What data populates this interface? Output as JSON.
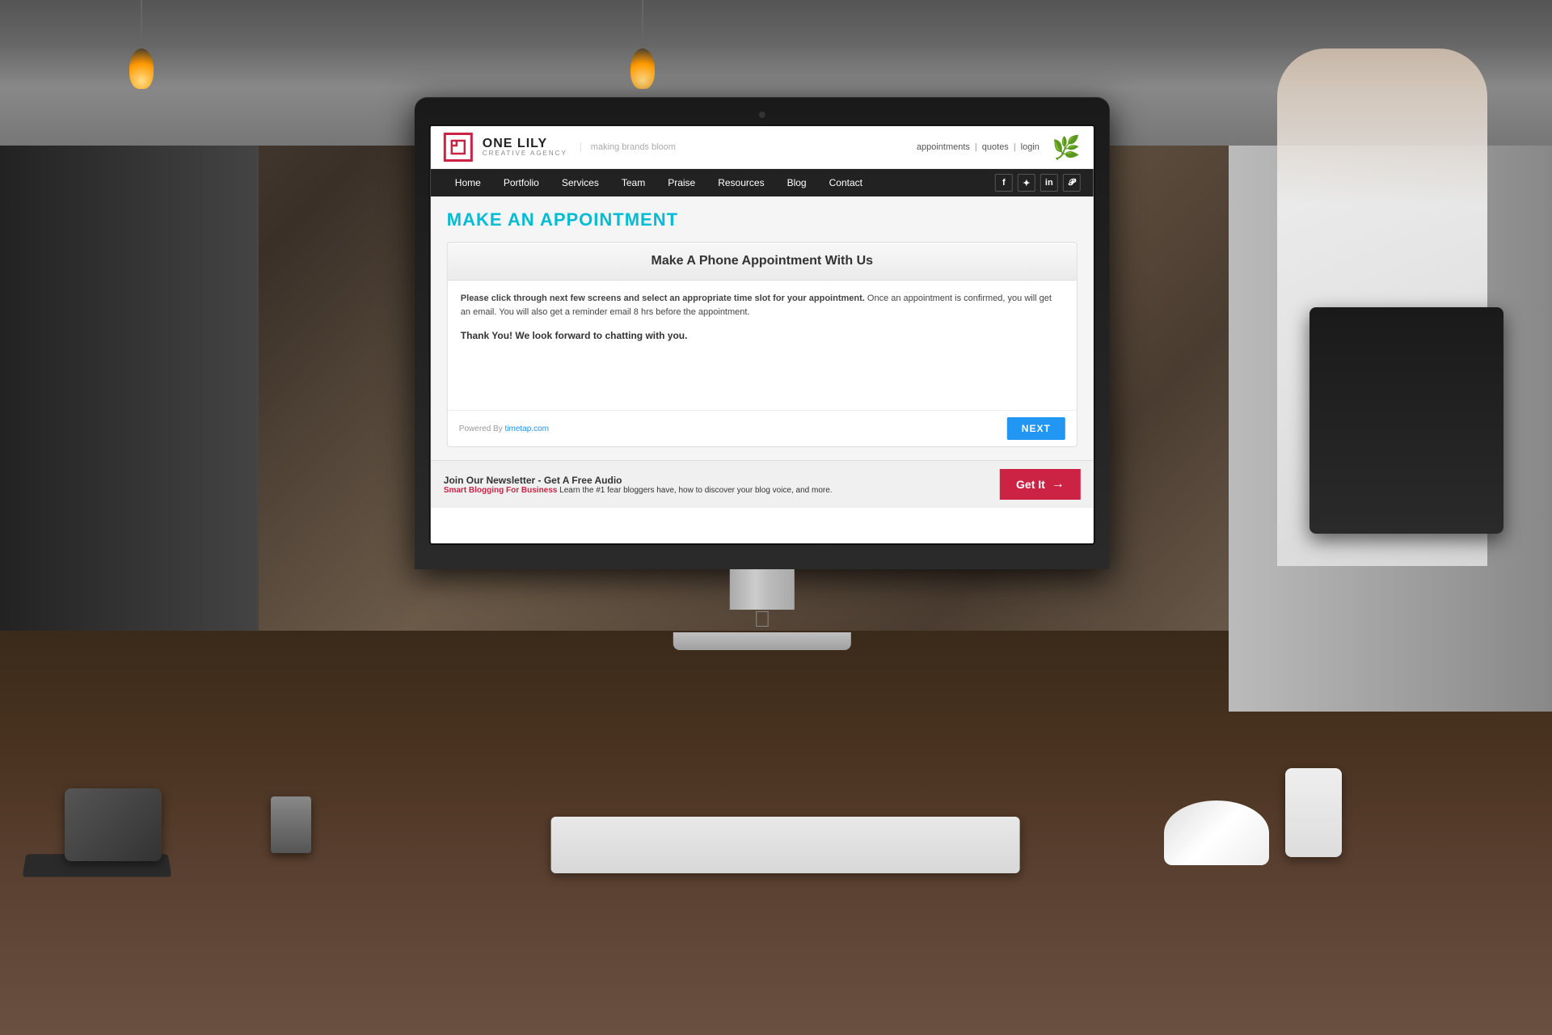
{
  "background": {
    "color": "#2a2a2a"
  },
  "website": {
    "header": {
      "logo_name": "ONE LILY",
      "logo_sub": "CREATIVE AGENCY",
      "logo_tagline": "making brands bloom",
      "top_links": {
        "appointments": "appointments",
        "quotes": "quotes",
        "login": "login",
        "separator": "|"
      }
    },
    "nav": {
      "items": [
        {
          "label": "Home"
        },
        {
          "label": "Portfolio"
        },
        {
          "label": "Services"
        },
        {
          "label": "Team"
        },
        {
          "label": "Praise"
        },
        {
          "label": "Resources"
        },
        {
          "label": "Blog"
        },
        {
          "label": "Contact"
        }
      ],
      "social": [
        "f",
        "t",
        "in",
        "p"
      ]
    },
    "page": {
      "title": "MAKE AN APPOINTMENT",
      "appointment_box": {
        "header": "Make A Phone Appointment With Us",
        "intro_bold": "Please click through next few screens and select an appropriate time slot for your appointment.",
        "intro_rest": " Once an appointment is confirmed, you will get an email. You will also get a reminder email 8 hrs before the appointment.",
        "thanks": "Thank You! We look forward to chatting with you.",
        "powered_by_label": "Powered By",
        "powered_by_link": "timetap.com",
        "next_button": "NEXT"
      }
    },
    "newsletter": {
      "main_label": "Join Our Newsletter - Get A Free Audio",
      "sub_bold": "Smart Blogging For Business",
      "sub_rest": " Learn the #1 fear bloggers have, how to discover your blog voice, and more.",
      "button_label": "Get It",
      "button_arrow": "→"
    }
  }
}
